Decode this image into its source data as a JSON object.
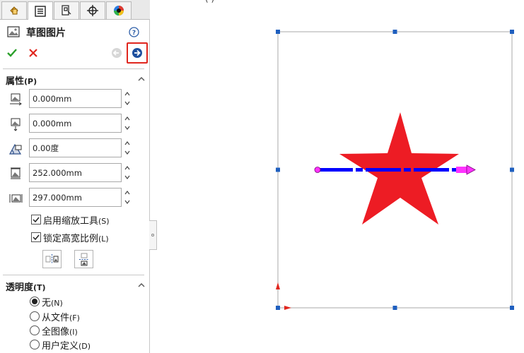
{
  "tabs": [
    {
      "name": "feature-manager",
      "icon": "feature-manager-icon"
    },
    {
      "name": "property-manager",
      "icon": "property-manager-icon",
      "active": true
    },
    {
      "name": "configuration-manager",
      "icon": "configuration-manager-icon"
    },
    {
      "name": "dimxpert-manager",
      "icon": "crosshair-icon"
    },
    {
      "name": "display-manager",
      "icon": "color-wheel-icon"
    }
  ],
  "title": "草图图片",
  "properties": {
    "heading": "属性",
    "hotkey": "(P)",
    "fields": [
      {
        "icon": "origin-x-icon",
        "value": "0.000mm"
      },
      {
        "icon": "origin-y-icon",
        "value": "0.000mm"
      },
      {
        "icon": "angle-icon",
        "value": "0.00度"
      },
      {
        "icon": "height-icon",
        "value": "252.000mm"
      },
      {
        "icon": "width-icon",
        "value": "297.000mm"
      }
    ],
    "checkboxes": [
      {
        "label": "启用缩放工具",
        "hotkey": "(S)",
        "checked": true
      },
      {
        "label": "锁定高宽比例",
        "hotkey": "(L)",
        "checked": true
      }
    ]
  },
  "transparency": {
    "heading": "透明度",
    "hotkey": "(T)",
    "options": [
      {
        "label": "无",
        "hotkey": "(N)",
        "selected": true
      },
      {
        "label": "从文件",
        "hotkey": "(F)",
        "selected": false
      },
      {
        "label": "全图像",
        "hotkey": "(I)",
        "selected": false
      },
      {
        "label": "用户定义",
        "hotkey": "(D)",
        "selected": false
      }
    ]
  },
  "canvas": {
    "top_label": "(          )",
    "star_color": "#ed1c24",
    "axis_color": "#0000ff",
    "handle_color": "#1f5fbf",
    "endpoint_color": "#ff33ff"
  }
}
